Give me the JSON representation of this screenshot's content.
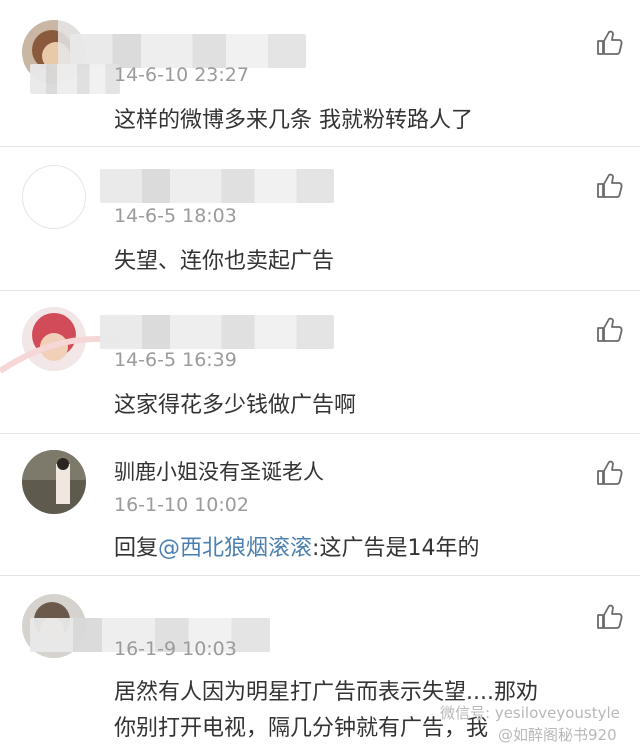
{
  "comments": [
    {
      "name": "",
      "time": "14-6-10 23:27",
      "text": "这样的微博多来几条 我就粉转路人了"
    },
    {
      "name": "",
      "time": "14-6-5 18:03",
      "text": "失望、连你也卖起广告"
    },
    {
      "name": "",
      "time": "14-6-5 16:39",
      "text": "这家得花多少钱做广告啊"
    },
    {
      "name": "驯鹿小姐没有圣诞老人",
      "time": "16-1-10 10:02",
      "reply_prefix": "回复",
      "mention": "@西北狼烟滚滚",
      "reply_text": ":这广告是14年的"
    },
    {
      "name": "",
      "time": "16-1-9 10:03",
      "text_line1": "居然有人因为明星打广告而表示失望....那劝",
      "text_line2": "你别打开电视，隔几分钟就有广告，我"
    }
  ],
  "icons": {
    "like": "thumbs-up-icon"
  },
  "watermark": {
    "line1": "微信号: yesiloveyoustyle",
    "line2": "@如醉阁秘书920"
  },
  "colors": {
    "text": "#333333",
    "time": "#9b9b9b",
    "mention": "#4a7fb0",
    "divider": "#e3e3e3"
  }
}
